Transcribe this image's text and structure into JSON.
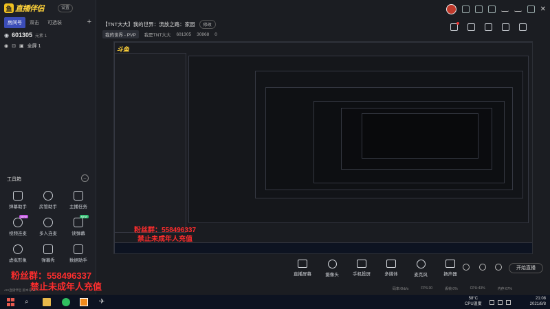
{
  "app": {
    "logo_text": "直播伴侣",
    "logo_badge": "斗鱼",
    "version_badge": "设置",
    "tabs": [
      "房间号",
      "双击",
      "可选装"
    ],
    "room_number": "601305",
    "room_sub": "元素 1",
    "scene_label": "全屏 1"
  },
  "header": {
    "title": "【TNT大大】我的世界：流放之路：家园",
    "modify_label": "修改",
    "category": "我的世界 - PVP",
    "streamer": "我是TNT大大",
    "room_id": "601305",
    "fans": "30868",
    "gift": "0"
  },
  "toolbox": {
    "title": "工具箱",
    "tools": [
      {
        "label": "弹幕助手",
        "badge": ""
      },
      {
        "label": "房管助手",
        "badge": ""
      },
      {
        "label": "主播任务",
        "badge": ""
      },
      {
        "label": "视频连麦",
        "badge": "NEW"
      },
      {
        "label": "多人连麦",
        "badge": ""
      },
      {
        "label": "读弹幕",
        "badge": "NEW"
      },
      {
        "label": "虚拟形象",
        "badge": ""
      },
      {
        "label": "弹幕秀",
        "badge": ""
      },
      {
        "label": "数据助手",
        "badge": ""
      }
    ]
  },
  "overlay": {
    "fan_group": "粉丝群：558496337",
    "notice": "禁止未成年人充值"
  },
  "controls": [
    {
      "label": "直播屏幕"
    },
    {
      "label": "摄像头"
    },
    {
      "label": "手机投屏"
    },
    {
      "label": "多媒体"
    },
    {
      "label": "麦克风"
    },
    {
      "label": "扬声器"
    }
  ],
  "go_live": "开始直播",
  "status": {
    "bitrate": "码率:0kb/s",
    "fps": "FPS:30",
    "lost": "丢帧:0%",
    "cpu": "CPU:43%",
    "mem": "内存:67%",
    "left_text": "AIS直播伴侣 版本号 5.3"
  },
  "taskbar": {
    "temp": "58°C",
    "temp_label": "CPU温度",
    "time": "21:08",
    "date": "2021/8/8"
  }
}
